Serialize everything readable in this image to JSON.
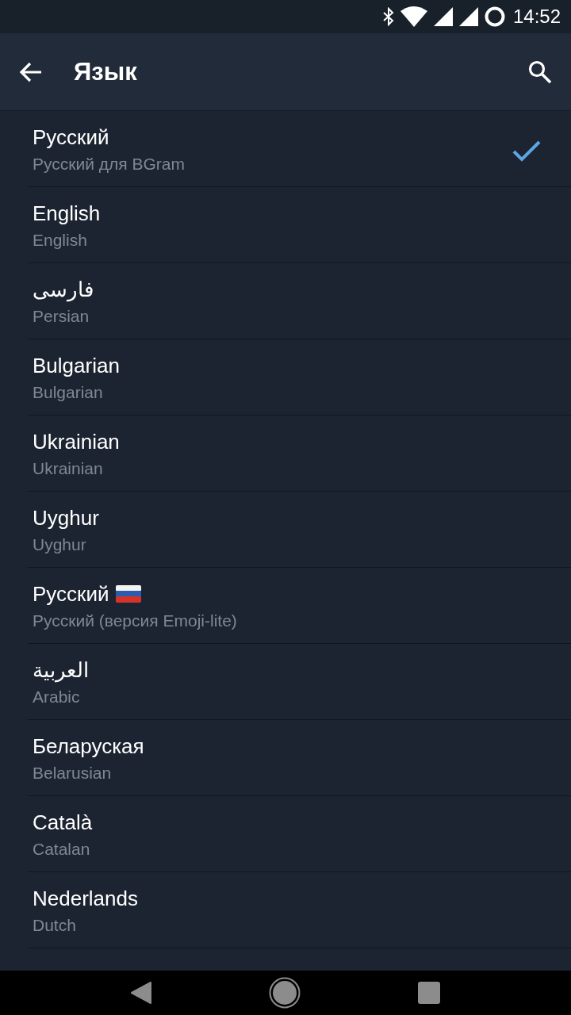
{
  "status_bar": {
    "time": "14:52"
  },
  "header": {
    "title": "Язык"
  },
  "languages": [
    {
      "name": "Русский",
      "subtitle": "Русский для BGram",
      "kind": "plain",
      "selected": true
    },
    {
      "name": "English",
      "subtitle": "English",
      "kind": "plain",
      "selected": false
    },
    {
      "name": "فارسی",
      "subtitle": "Persian",
      "kind": "plain",
      "selected": false
    },
    {
      "name": "Bulgarian",
      "subtitle": "Bulgarian",
      "kind": "plain",
      "selected": false
    },
    {
      "name": "Ukrainian",
      "subtitle": "Ukrainian",
      "kind": "plain",
      "selected": false
    },
    {
      "name": "Uyghur",
      "subtitle": "Uyghur",
      "kind": "plain",
      "selected": false
    },
    {
      "name": "Русский",
      "subtitle": "Русский (версия Emoji-lite)",
      "kind": "flagged",
      "selected": false
    },
    {
      "name": "العربية",
      "subtitle": "Arabic",
      "kind": "plain",
      "selected": false
    },
    {
      "name": "Беларуская",
      "subtitle": "Belarusian",
      "kind": "plain",
      "selected": false
    },
    {
      "name": "Català",
      "subtitle": "Catalan",
      "kind": "plain",
      "selected": false
    },
    {
      "name": "Nederlands",
      "subtitle": "Dutch",
      "kind": "plain",
      "selected": false
    }
  ]
}
